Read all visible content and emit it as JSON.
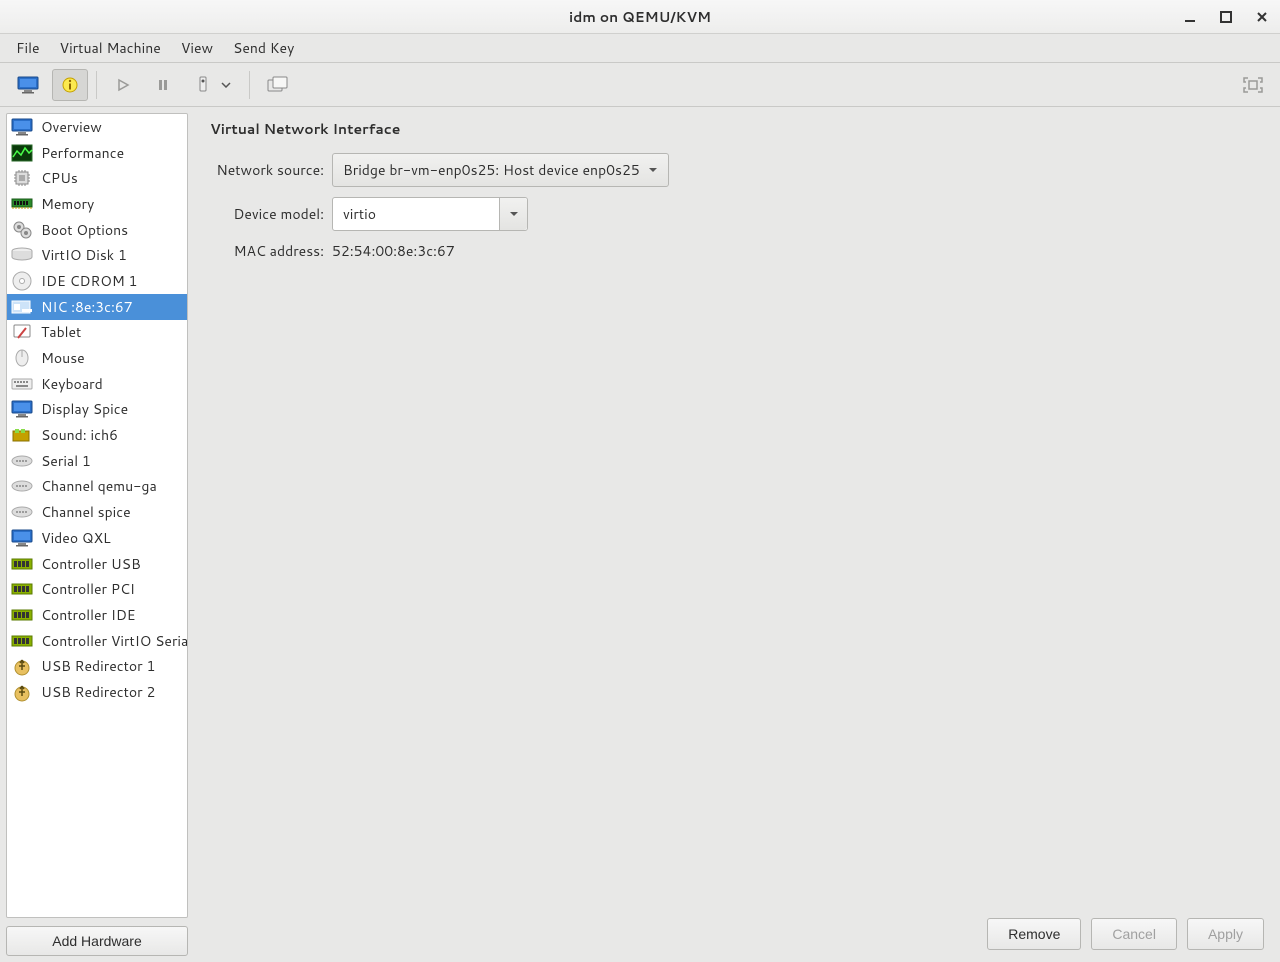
{
  "window": {
    "title": "idm on QEMU/KVM"
  },
  "menubar": {
    "items": [
      "File",
      "Virtual Machine",
      "View",
      "Send Key"
    ]
  },
  "sidebar": {
    "items": [
      {
        "label": "Overview",
        "icon": "monitor-blue"
      },
      {
        "label": "Performance",
        "icon": "perf"
      },
      {
        "label": "CPUs",
        "icon": "cpu"
      },
      {
        "label": "Memory",
        "icon": "mem"
      },
      {
        "label": "Boot Options",
        "icon": "boot"
      },
      {
        "label": "VirtIO Disk 1",
        "icon": "disk"
      },
      {
        "label": "IDE CDROM 1",
        "icon": "cdrom"
      },
      {
        "label": "NIC :8e:3c:67",
        "icon": "nic",
        "selected": true
      },
      {
        "label": "Tablet",
        "icon": "tablet"
      },
      {
        "label": "Mouse",
        "icon": "mouse"
      },
      {
        "label": "Keyboard",
        "icon": "keyboard"
      },
      {
        "label": "Display Spice",
        "icon": "monitor-blue"
      },
      {
        "label": "Sound: ich6",
        "icon": "sound"
      },
      {
        "label": "Serial 1",
        "icon": "serial"
      },
      {
        "label": "Channel qemu-ga",
        "icon": "serial"
      },
      {
        "label": "Channel spice",
        "icon": "serial"
      },
      {
        "label": "Video QXL",
        "icon": "monitor-blue"
      },
      {
        "label": "Controller USB",
        "icon": "controller"
      },
      {
        "label": "Controller PCI",
        "icon": "controller"
      },
      {
        "label": "Controller IDE",
        "icon": "controller"
      },
      {
        "label": "Controller VirtIO Serial",
        "icon": "controller"
      },
      {
        "label": "USB Redirector 1",
        "icon": "usb"
      },
      {
        "label": "USB Redirector 2",
        "icon": "usb"
      }
    ],
    "add_hw_label": "Add Hardware"
  },
  "details": {
    "title": "Virtual Network Interface",
    "network_source": {
      "label": "Network source:",
      "value": "Bridge br-vm-enp0s25: Host device enp0s25"
    },
    "device_model": {
      "label": "Device model:",
      "value": "virtio"
    },
    "mac_address": {
      "label": "MAC address:",
      "value": "52:54:00:8e:3c:67"
    }
  },
  "actions": {
    "remove": "Remove",
    "cancel": "Cancel",
    "apply": "Apply"
  }
}
